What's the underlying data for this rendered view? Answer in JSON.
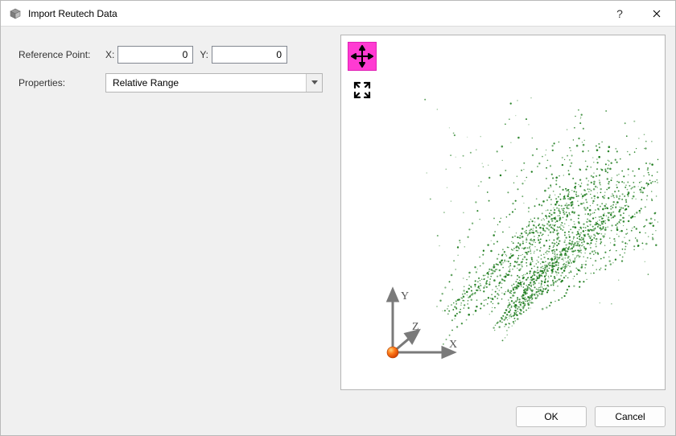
{
  "window": {
    "title": "Import Reutech Data"
  },
  "form": {
    "ref_label": "Reference Point:",
    "x_label": "X:",
    "x_value": "0",
    "y_label": "Y:",
    "y_value": "0",
    "props_label": "Properties:",
    "props_selected": "Relative Range"
  },
  "axes": {
    "x": "X",
    "y": "Y",
    "z": "Z"
  },
  "buttons": {
    "ok": "OK",
    "cancel": "Cancel",
    "help": "?"
  }
}
